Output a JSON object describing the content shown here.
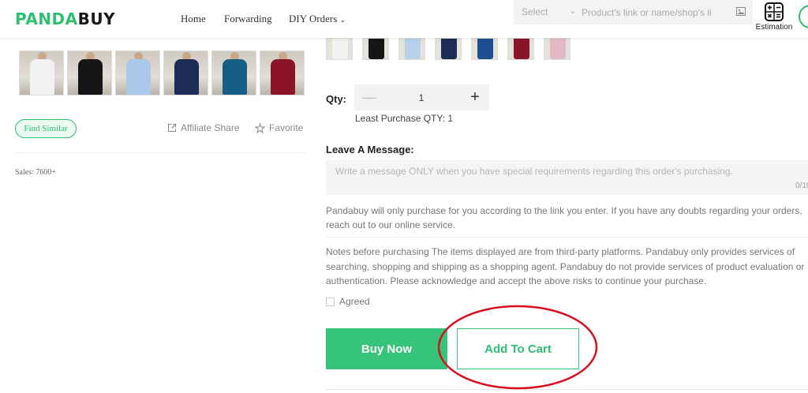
{
  "header": {
    "logo_part1": "PANDA",
    "logo_part2": "BUY",
    "nav": {
      "home": "Home",
      "forwarding": "Forwarding",
      "diy_orders": "DIY Orders"
    },
    "search": {
      "select_label": "Select",
      "placeholder": "Product's link or name/shop's li"
    },
    "estimation_label": "Estimation"
  },
  "product": {
    "thumbnails": [
      {
        "shirt_color": "#f2f2f2"
      },
      {
        "shirt_color": "#161616"
      },
      {
        "shirt_color": "#a9c8ea"
      },
      {
        "shirt_color": "#1d2c55"
      },
      {
        "shirt_color": "#175e84"
      },
      {
        "shirt_color": "#8a1529"
      }
    ],
    "find_similar_label": "Find Similar",
    "affiliate_share_label": "Affiliate Share",
    "favorite_label": "Favorite",
    "sales_text": "Sales: 7600+"
  },
  "color_options": [
    {
      "shirt_color": "#f2f2f2"
    },
    {
      "shirt_color": "#161616"
    },
    {
      "shirt_color": "#b7d0ec"
    },
    {
      "shirt_color": "#1d2c55"
    },
    {
      "shirt_color": "#1e4f90"
    },
    {
      "shirt_color": "#8a1529"
    },
    {
      "shirt_color": "#e3b8c7"
    }
  ],
  "quantity": {
    "label": "Qty:",
    "value": "1",
    "least_text": "Least Purchase QTY: 1"
  },
  "message": {
    "label": "Leave A Message:",
    "placeholder": "Write a message ONLY when you have special requirements regarding this order's purchasing.",
    "counter": "0/10"
  },
  "info_text": "Pandabuy will only purchase for you according to the link you enter. If you have any doubts regarding your orders, reach out to our online service.",
  "notes_text": "Notes before purchasing The items displayed are from third-party platforms. Pandabuy only provides services of searching, shopping and shipping as a shopping agent. Pandabuy do not provide services of product evaluation or authentication. Please acknowledge and accept the above risks to continue your purchase.",
  "agreed_label": "Agreed",
  "buttons": {
    "buy_now": "Buy Now",
    "add_to_cart": "Add To Cart"
  },
  "colors": {
    "accent": "#2fbf71",
    "highlight": "#d6101e"
  }
}
